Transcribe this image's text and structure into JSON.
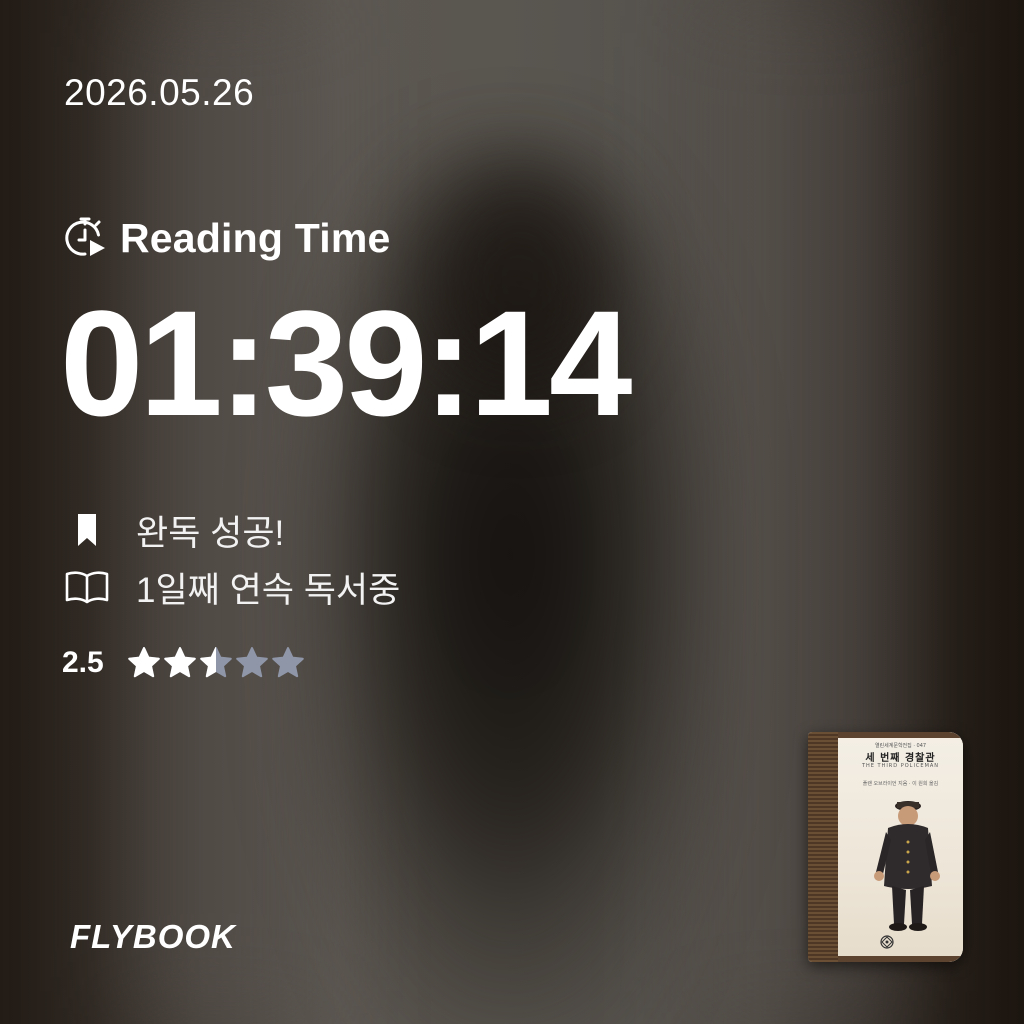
{
  "date": "2026.05.26",
  "reading_time": {
    "label": "Reading Time",
    "icon": "stopwatch-play-icon",
    "value": "01:39:14"
  },
  "status": [
    {
      "icon": "bookmark-icon",
      "text": "완독 성공!"
    },
    {
      "icon": "open-book-icon",
      "text": "1일째 연속 독서중"
    }
  ],
  "rating": {
    "value_text": "2.5",
    "value": 2.5,
    "max": 5,
    "filled_color": "#ffffff",
    "empty_color": "#8f96a8"
  },
  "brand": "FLYBOOK",
  "book": {
    "title": "세 번째 경찰관",
    "subtitle": "THE THIRD POLICEMAN",
    "series": "열린세계문학전집 · 047",
    "author": "플랜 오브라이언 지음 · 이 원희 옮김",
    "spine_color": "#5b4330"
  }
}
